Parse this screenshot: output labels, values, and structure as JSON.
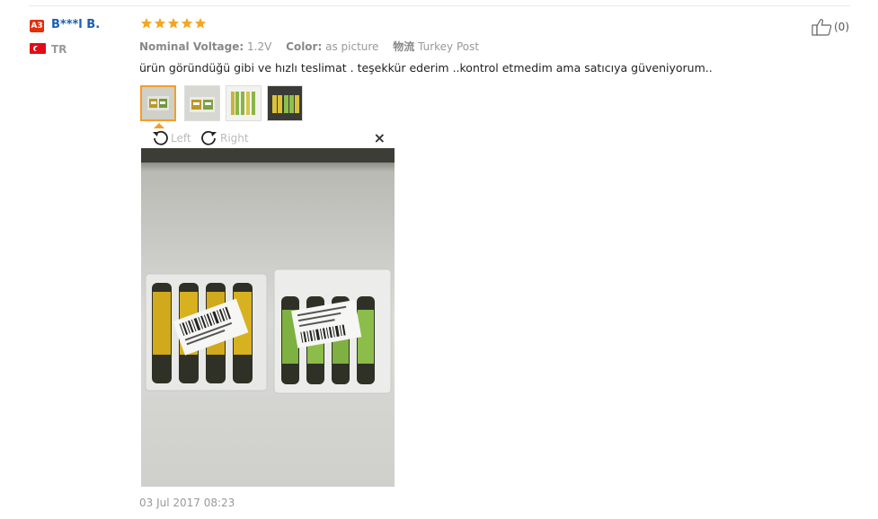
{
  "reviewer": {
    "level_badge": "A3",
    "name": "B***l B.",
    "country": "TR"
  },
  "rating": {
    "stars": 5,
    "max": 5,
    "color": "#f5a623"
  },
  "attributes": [
    {
      "name": "Nominal Voltage:",
      "value": "1.2V"
    },
    {
      "name": "Color:",
      "value": "as picture"
    },
    {
      "name": "物流",
      "value": "Turkey Post"
    }
  ],
  "review_text": "ürün göründüğü gibi ve hızlı teslimat . teşekkür ederim ..kontrol etmedim ama satıcıya güveniyorum..",
  "thumbnails": {
    "count": 4,
    "selected_index": 0
  },
  "viewer": {
    "rotate_left_label": "Left",
    "rotate_right_label": "Right",
    "close_label": "×"
  },
  "date": "03 Jul 2017 08:23",
  "like": {
    "count": "(0)"
  },
  "colors": {
    "accent": "#f59d2a",
    "name_link": "#1a5fb4",
    "badge": "#e62e04"
  }
}
